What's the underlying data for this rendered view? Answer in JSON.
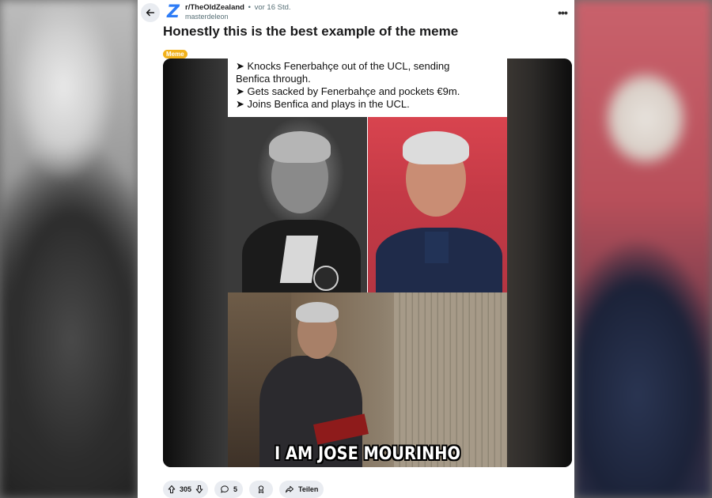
{
  "post": {
    "subreddit": "r/TheOldZealand",
    "separator": "•",
    "time": "vor 16 Std.",
    "author": "masterdeleon",
    "title": "Honestly this is the best example of the meme",
    "flair": "Meme",
    "flair_color": "#f2b21b"
  },
  "meme": {
    "lines": [
      "➤ Knocks Fenerbahçe out of the UCL, sending",
      "Benfica through.",
      "➤ Gets sacked by Fenerbahçe and pockets €9m.",
      "➤ Joins Benfica and plays in the UCL."
    ],
    "caption": "I AM JOSE MOURINHO"
  },
  "actions": {
    "upvotes": "305",
    "comments": "5",
    "share_label": "Teilen"
  },
  "icons": {
    "back": "arrow-left-icon",
    "more": "more-dots-icon",
    "upvote": "arrow-up-icon",
    "downvote": "arrow-down-icon",
    "comment": "speech-bubble-icon",
    "award": "award-icon",
    "share": "share-arrow-icon"
  },
  "colors": {
    "accent": "#2e7cf6",
    "pill_bg": "#e9ecf1"
  }
}
